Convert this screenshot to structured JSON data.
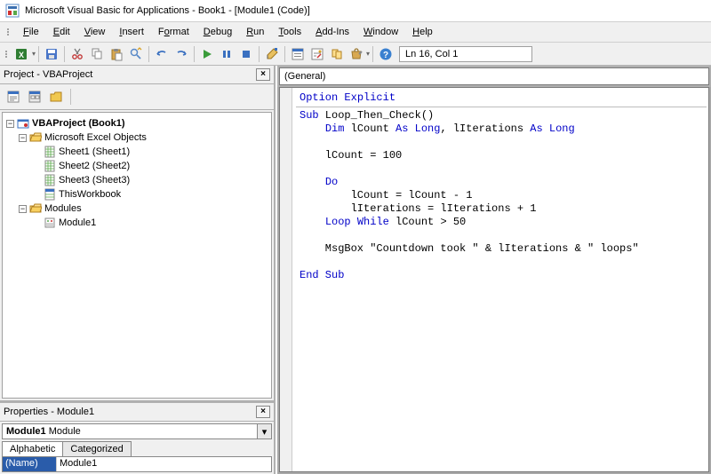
{
  "title": "Microsoft Visual Basic for Applications - Book1 - [Module1 (Code)]",
  "menu": {
    "file": "File",
    "edit": "Edit",
    "view": "View",
    "insert": "Insert",
    "format": "Format",
    "debug": "Debug",
    "run": "Run",
    "tools": "Tools",
    "addins": "Add-Ins",
    "window": "Window",
    "help": "Help"
  },
  "toolbar": {
    "cursor_pos": "Ln 16, Col 1"
  },
  "project": {
    "panel_title": "Project - VBAProject",
    "root": "VBAProject (Book1)",
    "folder_excel": "Microsoft Excel Objects",
    "sheet1": "Sheet1 (Sheet1)",
    "sheet2": "Sheet2 (Sheet2)",
    "sheet3": "Sheet3 (Sheet3)",
    "thiswb": "ThisWorkbook",
    "folder_modules": "Modules",
    "module1": "Module1"
  },
  "properties": {
    "panel_title": "Properties - Module1",
    "object_name": "Module1",
    "object_type": "Module",
    "tab_alpha": "Alphabetic",
    "tab_cat": "Categorized",
    "prop_name_label": "(Name)",
    "prop_name_value": "Module1"
  },
  "codewin": {
    "object_box": "(General)"
  },
  "code": {
    "l1a": "Option",
    "l1b": "Explicit",
    "l2a": "Sub",
    "l2b": " Loop_Then_Check()",
    "l3a": "Dim",
    "l3b": " lCount ",
    "l3c": "As Long",
    "l3d": ", lIterations ",
    "l3e": "As Long",
    "l4": "    lCount = 100",
    "l5": "Do",
    "l6": "        lCount = lCount - 1",
    "l7": "        lIterations = lIterations + 1",
    "l8a": "Loop While",
    "l8b": " lCount > 50",
    "l9": "    MsgBox \"Countdown took \" & lIterations & \" loops\"",
    "l10": "End Sub"
  }
}
